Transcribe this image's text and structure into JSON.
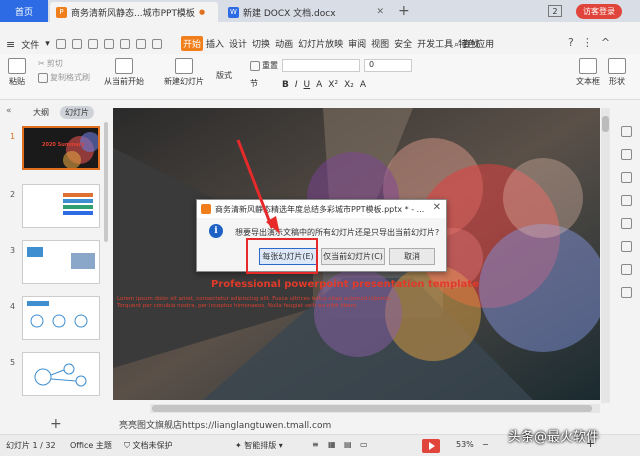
{
  "titlebar": {
    "home": "首页",
    "tabs": [
      {
        "label": "商务清新风静态...城市PPT模板",
        "icon": "P",
        "color": "#f07e1b"
      },
      {
        "label": "新建 DOCX 文档.docx",
        "icon": "W",
        "color": "#2d6be4"
      }
    ],
    "new_tab": "+",
    "window_count": "2",
    "login": "访客登录"
  },
  "menubar": {
    "hamburger": "≡",
    "file": "文件",
    "tabs": [
      "开始",
      "插入",
      "设计",
      "切换",
      "动画",
      "幻灯片放映",
      "审阅",
      "视图",
      "安全",
      "开发工具",
      "特色应用"
    ],
    "search": "查找"
  },
  "ribbon": {
    "paste": "粘贴",
    "cut": "剪切",
    "copy": "复制",
    "format_painter": "格式刷",
    "play_from_current": "从当前开始",
    "new_slide": "新建幻灯片",
    "layout": "版式",
    "section": "节",
    "reset": "重置",
    "font_size": "0",
    "text_box": "文本框",
    "shape": "形状",
    "format_buttons": [
      "B",
      "I",
      "U",
      "A",
      "X²",
      "X₂",
      "A"
    ]
  },
  "panel": {
    "tab_outline": "大纲",
    "tab_slides": "幻灯片",
    "slides": [
      "1",
      "2",
      "3",
      "4",
      "5"
    ],
    "thumb_title": "2020 Summary",
    "add": "+"
  },
  "slide": {
    "title": "Professional powerpoint presentation template",
    "subtitle": "Lorem ipsum dolor sit amet, consectetur adipiscing elit. Fusce ultrices tellus vitae euismod lobortis. Torquent per conubia nostra, per inceptos himenaeos. Nulla feugiat velit eu nibh libero."
  },
  "notes": "亮亮图文旗舰店https://lianglangtuwen.tmall.com",
  "statusbar": {
    "slide_count": "幻灯片 1 / 32",
    "theme": "Office 主题",
    "protect": "文档未保护",
    "smart": "智能排版",
    "zoom": "53%",
    "zoom_minus": "−",
    "zoom_plus": "+"
  },
  "dialog": {
    "title": "商务清新风静态精选年度总结多彩城市PPT模板.pptx * - ...",
    "close": "✕",
    "message": "想要导出演示文稿中的所有幻灯片还是只导出当前幻灯片?",
    "btn_each": "每张幻灯片(E)",
    "btn_current": "仅当前幻灯片(C)",
    "btn_cancel": "取消",
    "info_icon": "i"
  },
  "watermark": "头条@最火软件",
  "colors": {
    "accent": "#f07e1b",
    "blue": "#2d6be4",
    "red": "#e62a2a"
  }
}
